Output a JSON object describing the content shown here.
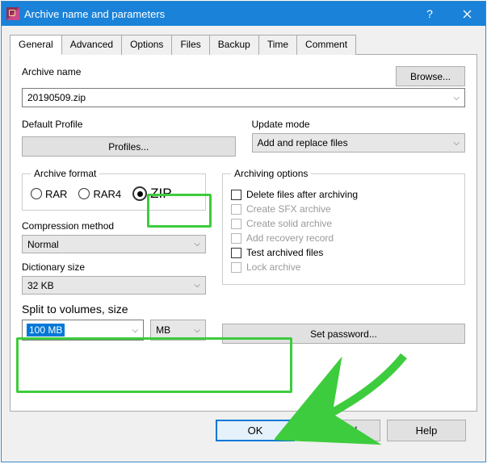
{
  "title": "Archive name and parameters",
  "tabs": [
    "General",
    "Advanced",
    "Options",
    "Files",
    "Backup",
    "Time",
    "Comment"
  ],
  "active_tab": 0,
  "archive_name_label": "Archive name",
  "archive_name_value": "20190509.zip",
  "browse_label": "Browse...",
  "default_profile_label": "Default Profile",
  "profiles_label": "Profiles...",
  "update_mode_label": "Update mode",
  "update_mode_value": "Add and replace files",
  "archive_format": {
    "legend": "Archive format",
    "options": [
      "RAR",
      "RAR4",
      "ZIP"
    ],
    "selected": "ZIP"
  },
  "compression_label": "Compression method",
  "compression_value": "Normal",
  "dictionary_label": "Dictionary size",
  "dictionary_value": "32 KB",
  "split": {
    "label": "Split to volumes, size",
    "value": "100 MB",
    "unit": "MB"
  },
  "archiving_options": {
    "legend": "Archiving options",
    "items": [
      {
        "label": "Delete files after archiving",
        "checked": false,
        "enabled": true
      },
      {
        "label": "Create SFX archive",
        "checked": false,
        "enabled": false
      },
      {
        "label": "Create solid archive",
        "checked": false,
        "enabled": false
      },
      {
        "label": "Add recovery record",
        "checked": false,
        "enabled": false
      },
      {
        "label": "Test archived files",
        "checked": false,
        "enabled": true
      },
      {
        "label": "Lock archive",
        "checked": false,
        "enabled": false
      }
    ]
  },
  "set_password_label": "Set password...",
  "buttons": {
    "ok": "OK",
    "cancel": "Cancel",
    "help": "Help"
  }
}
